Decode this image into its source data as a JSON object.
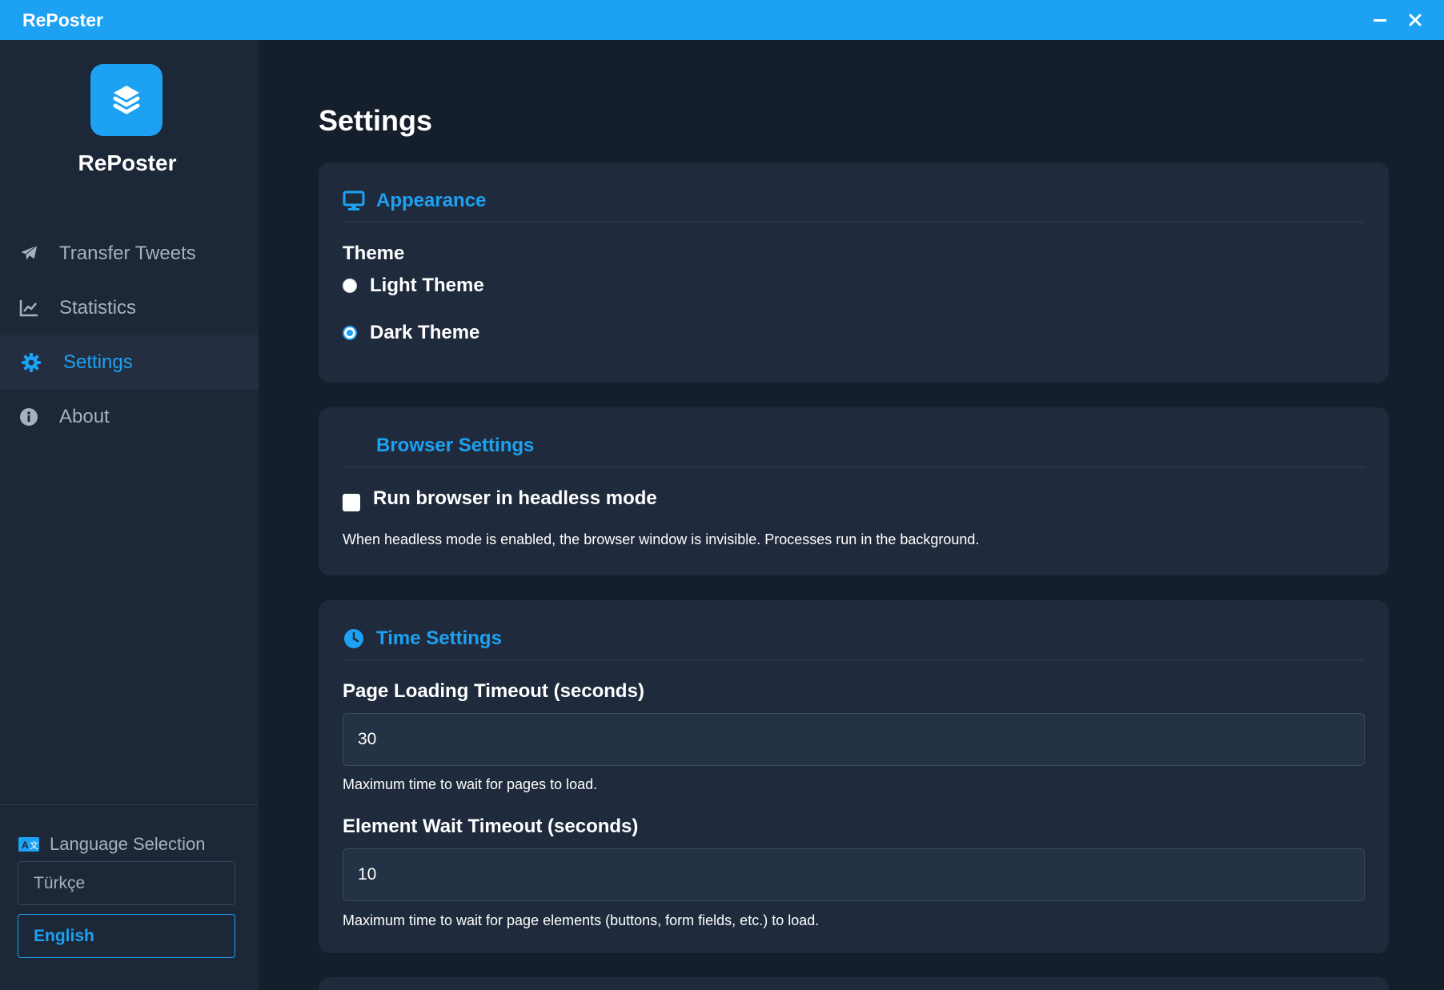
{
  "window": {
    "title": "RePoster",
    "minimize_glyph": "–",
    "close_glyph": "✕"
  },
  "sidebar": {
    "brand": "RePoster",
    "logo_icon": "layers-icon",
    "items": [
      {
        "label": "Transfer Tweets",
        "icon": "paper-plane-icon",
        "active": false
      },
      {
        "label": "Statistics",
        "icon": "line-chart-icon",
        "active": false
      },
      {
        "label": "Settings",
        "icon": "gear-icon",
        "active": true
      },
      {
        "label": "About",
        "icon": "info-icon",
        "active": false
      }
    ],
    "language": {
      "header": "Language Selection",
      "icon": "language-icon",
      "options": [
        {
          "label": "Türkçe",
          "selected": false
        },
        {
          "label": "English",
          "selected": true
        }
      ]
    }
  },
  "main": {
    "title": "Settings",
    "appearance": {
      "title": "Appearance",
      "icon": "monitor-icon",
      "theme_label": "Theme",
      "options": [
        {
          "label": "Light Theme",
          "checked": false
        },
        {
          "label": "Dark Theme",
          "checked": true
        }
      ]
    },
    "browser": {
      "title": "Browser Settings",
      "headless_label": "Run browser in headless mode",
      "headless_checked": false,
      "help": "When headless mode is enabled, the browser window is invisible. Processes run in the background."
    },
    "time": {
      "title": "Time Settings",
      "icon": "clock-icon",
      "page_timeout_label": "Page Loading Timeout (seconds)",
      "page_timeout_value": "30",
      "page_timeout_help": "Maximum time to wait for pages to load.",
      "element_timeout_label": "Element Wait Timeout (seconds)",
      "element_timeout_value": "10",
      "element_timeout_help": "Maximum time to wait for page elements (buttons, form fields, etc.) to load."
    }
  },
  "colors": {
    "accent": "#1da1f2",
    "background": "#151e2b",
    "sidebar": "#1c2737",
    "card": "#1f2b3c"
  }
}
